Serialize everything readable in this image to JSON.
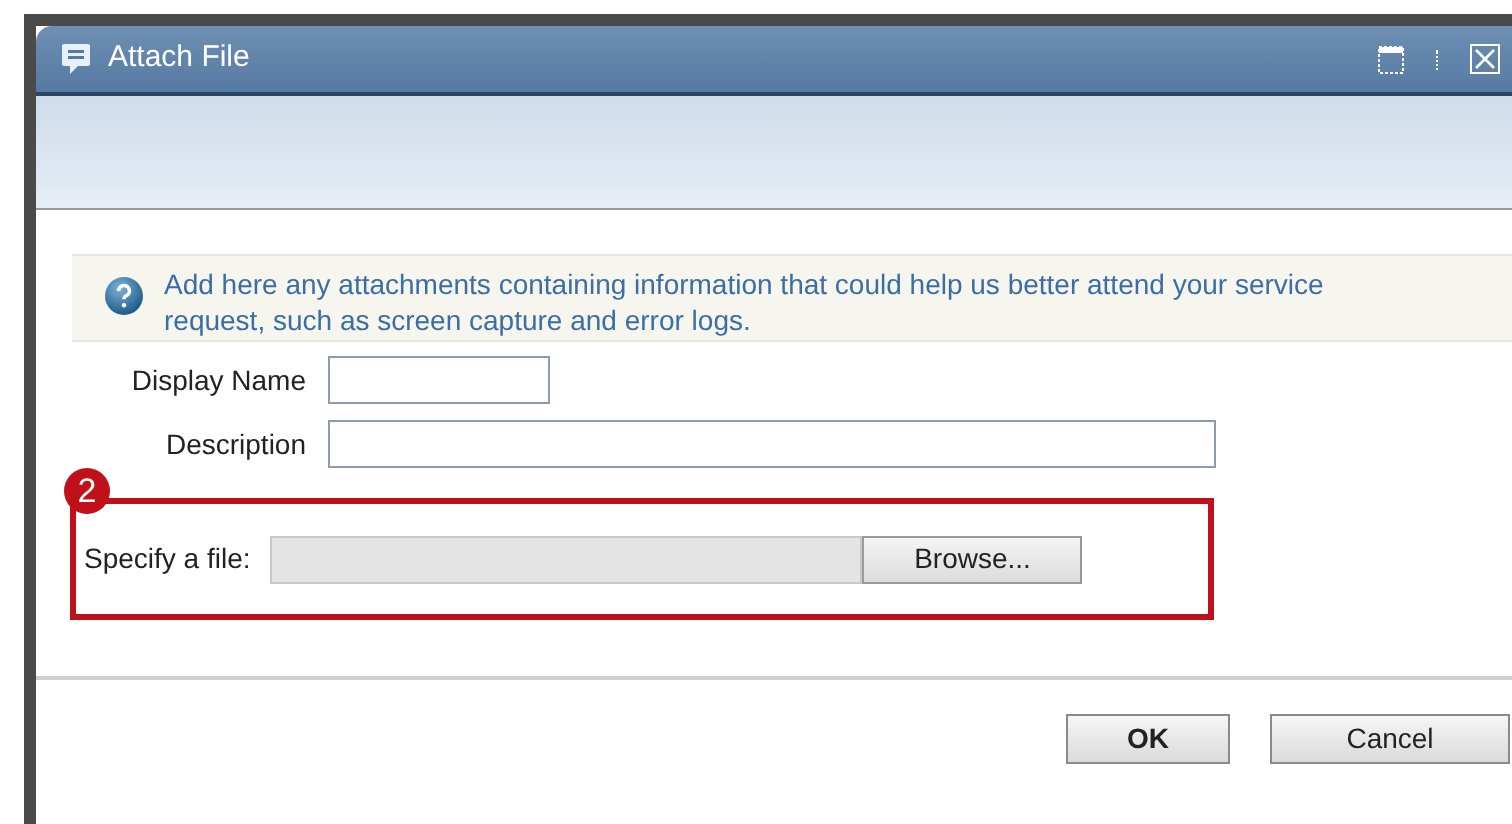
{
  "window": {
    "title": "Attach File"
  },
  "info": "Add here any attachments containing information that could help us better attend your service request, such as screen capture and error logs.",
  "fields": [
    {
      "label": "Display Name",
      "kind": "short"
    },
    {
      "label": "Description",
      "kind": "long"
    }
  ],
  "callout": {
    "number": "2"
  },
  "file": {
    "label": "Specify a file:",
    "button": "Browse..."
  },
  "buttons": [
    {
      "label": "OK",
      "default": true
    },
    {
      "label": "Cancel",
      "default": false
    }
  ]
}
